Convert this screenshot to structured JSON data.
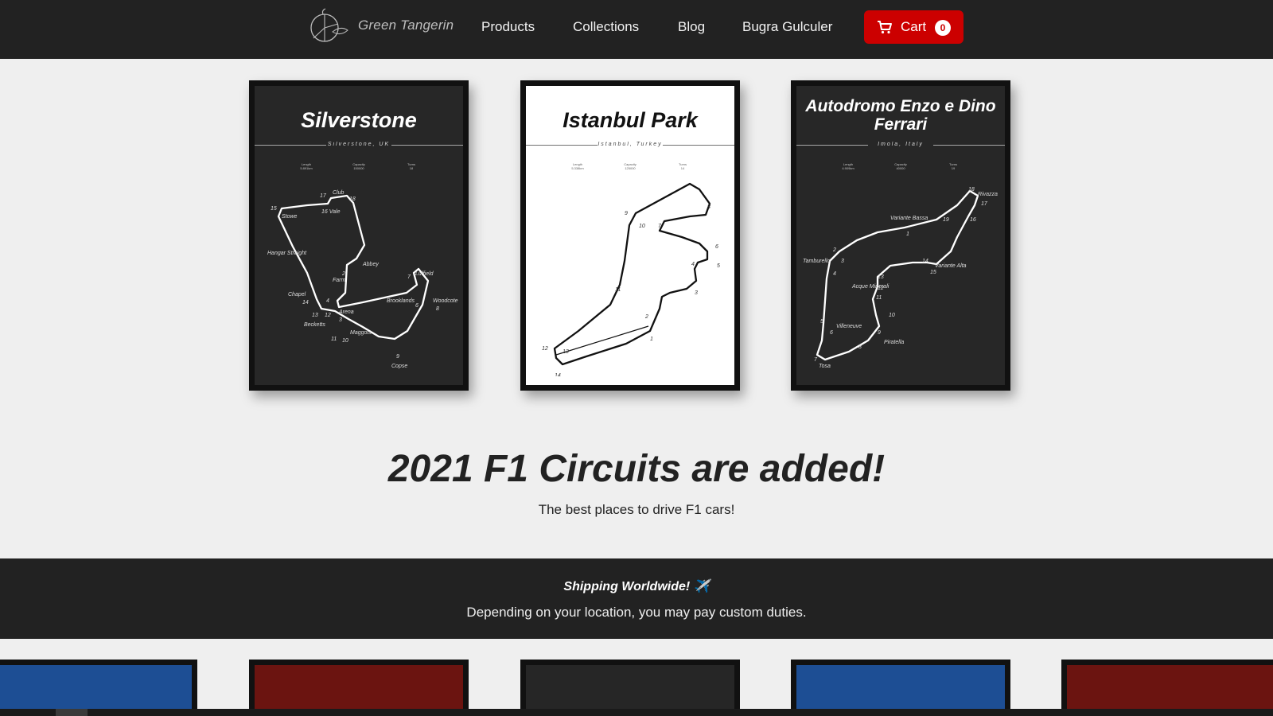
{
  "nav": {
    "logo_text": "Green Tangerin",
    "links": [
      "Products",
      "Collections",
      "Blog",
      "Bugra Gulculer"
    ],
    "cart_label": "Cart",
    "cart_count": "0"
  },
  "posters": [
    {
      "title": "Silverstone",
      "location": "Silverstone, UK",
      "stats": [
        "Length",
        "Capacity",
        "Turns"
      ],
      "stat_values": [
        "5.891km",
        "150000",
        "18"
      ],
      "labels": [
        "17",
        "Club",
        "18",
        "15",
        "Stowe",
        "16 Vale",
        "Hangar Straight",
        "Abbey",
        "2",
        "Farm",
        "Luffield",
        "7",
        "Chapel",
        "14",
        "4",
        "Arena",
        "Brooklands",
        "6",
        "Woodcote",
        "8",
        "13",
        "12",
        "3",
        "Becketts",
        "Maggots",
        "11",
        "10",
        "9",
        "Copse"
      ]
    },
    {
      "title": "Istanbul Park",
      "location": "Istanbul, Turkey",
      "stats": [
        "Length",
        "Capacity",
        "Turns"
      ],
      "stat_values": [
        "5.338km",
        "125000",
        "14"
      ],
      "labels": [
        "8",
        "9",
        "10",
        "7",
        "6",
        "4",
        "5",
        "3",
        "11",
        "2",
        "1",
        "12",
        "13",
        "14"
      ]
    },
    {
      "title": "Autodromo Enzo e Dino Ferrari",
      "location": "Imola, Italy",
      "stats": [
        "Length",
        "Capacity",
        "Turns"
      ],
      "stat_values": [
        "4.909km",
        "40000",
        "19"
      ],
      "labels": [
        "18",
        "Rivazza",
        "17",
        "16",
        "Variante Bassa",
        "19",
        "1",
        "2",
        "Tamburello",
        "3",
        "4",
        "14",
        "Variante Alta",
        "15",
        "13",
        "Acque Minerali",
        "12",
        "11",
        "10",
        "5",
        "Villeneuve",
        "6",
        "9",
        "Piratella",
        "8",
        "7",
        "Tosa"
      ]
    }
  ],
  "hero": {
    "title": "2021 F1 Circuits are added!",
    "subtitle": "The best places to drive F1 cars!"
  },
  "shipping": {
    "title": "Shipping Worldwide! ✈️",
    "subtitle": "Depending on your location, you may pay custom duties."
  },
  "colors": {
    "nav_bg": "#222222",
    "cart_red": "#cc0000",
    "page_bg": "#efefef",
    "frame_colors": [
      "#1d4e94",
      "#6b1410",
      "#262626",
      "#1d4e94",
      "#6b1410"
    ]
  }
}
